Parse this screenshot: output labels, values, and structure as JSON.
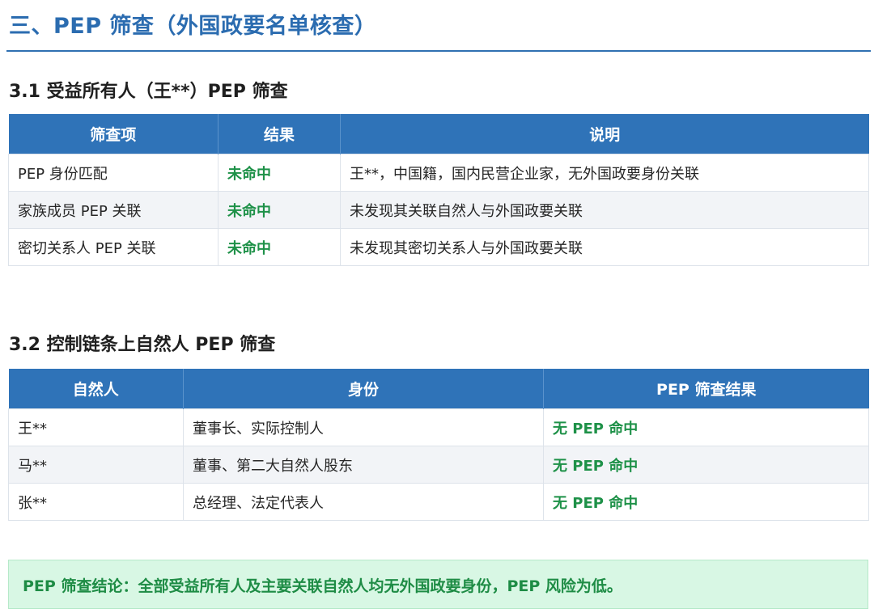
{
  "section": {
    "title": "三、PEP 筛查（外国政要名单核查）"
  },
  "sub1": {
    "title": "3.1 受益所有人（王**）PEP 筛查",
    "headers": [
      "筛查项",
      "结果",
      "说明"
    ],
    "rows": [
      {
        "item": "PEP 身份匹配",
        "result": "未命中",
        "note": "王**，中国籍，国内民营企业家，无外国政要身份关联"
      },
      {
        "item": "家族成员 PEP 关联",
        "result": "未命中",
        "note": "未发现其关联自然人与外国政要关联"
      },
      {
        "item": "密切关系人 PEP 关联",
        "result": "未命中",
        "note": "未发现其密切关系人与外国政要关联"
      }
    ]
  },
  "sub2": {
    "title": "3.2 控制链条上自然人 PEP 筛查",
    "headers": [
      "自然人",
      "身份",
      "PEP 筛查结果"
    ],
    "rows": [
      {
        "person": "王**",
        "role": "董事长、实际控制人",
        "result": "无 PEP 命中"
      },
      {
        "person": "马**",
        "role": "董事、第二大自然人股东",
        "result": "无 PEP 命中"
      },
      {
        "person": "张**",
        "role": "总经理、法定代表人",
        "result": "无 PEP 命中"
      }
    ]
  },
  "conclusion": {
    "text": "PEP 筛查结论：全部受益所有人及主要关联自然人均无外国政要身份，PEP 风险为低。"
  },
  "colors": {
    "accent": "#2f73b8",
    "hit_green": "#1e9148",
    "conclusion_bg": "#d8f7e4"
  }
}
